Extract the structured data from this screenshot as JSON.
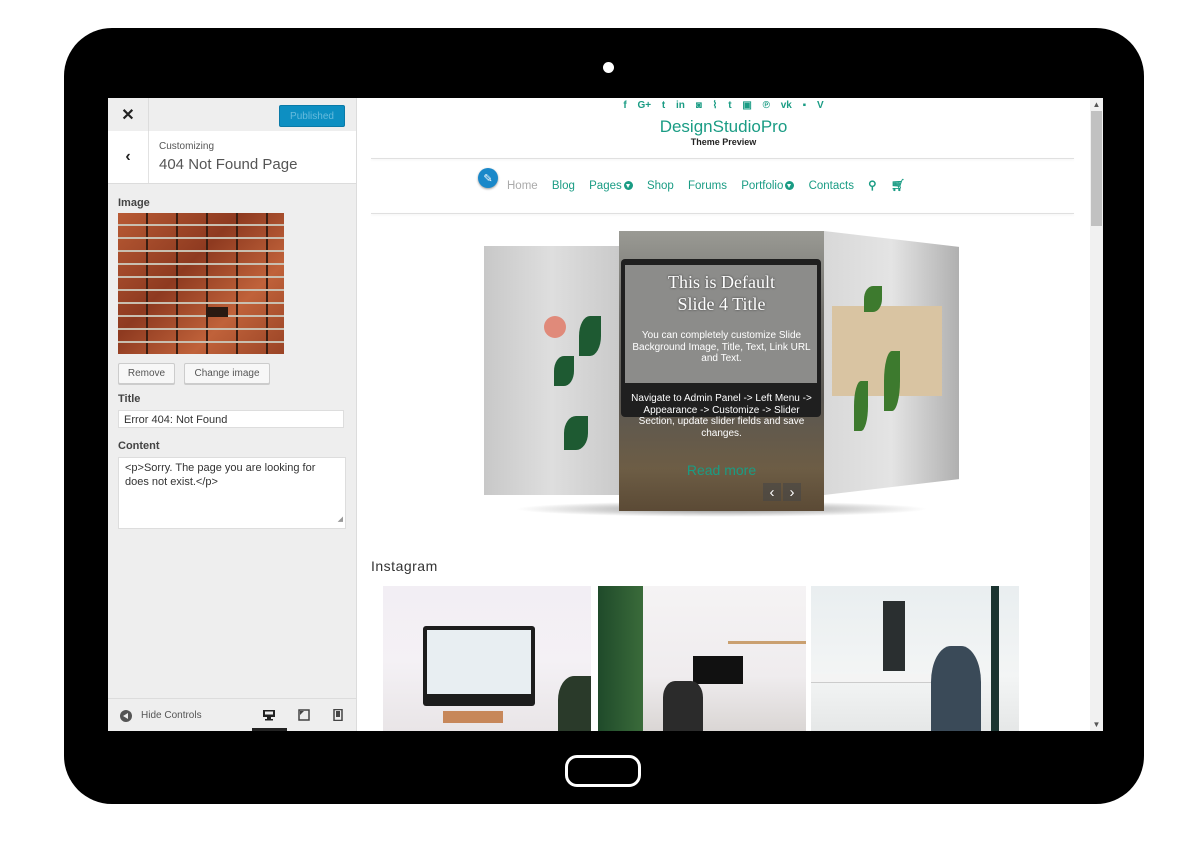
{
  "customizer": {
    "close_icon": "close-icon",
    "publish_label": "Published",
    "back_icon": "chevron-left-icon",
    "breadcrumb": "Customizing",
    "section_title": "404 Not Found Page",
    "image_label": "Image",
    "remove_label": "Remove",
    "change_image_label": "Change image",
    "title_label": "Title",
    "title_value": "Error 404: Not Found",
    "content_label": "Content",
    "content_value": "<p>Sorry. The page you are looking for does not exist.</p>",
    "footer": {
      "hide_controls_label": "Hide Controls",
      "devices": [
        "desktop",
        "tablet",
        "mobile"
      ],
      "active_device": "desktop"
    }
  },
  "preview": {
    "social_icons": [
      "f",
      "G+",
      "t",
      "in",
      "◙",
      "⌇",
      "t",
      "▣",
      "℗",
      "vk",
      "▪",
      "V"
    ],
    "social_names": [
      "facebook",
      "google-plus",
      "twitter",
      "linkedin",
      "instagram",
      "rss",
      "tumblr",
      "youtube",
      "pinterest",
      "vk",
      "flickr",
      "vine"
    ],
    "site_title": "DesignStudioPro",
    "tagline": "Theme Preview",
    "nav": {
      "home": "Home",
      "blog": "Blog",
      "pages": "Pages",
      "shop": "Shop",
      "forums": "Forums",
      "portfolio": "Portfolio",
      "contacts": "Contacts"
    },
    "slider": {
      "title_line1": "This is Default",
      "title_line2": "Slide 4 Title",
      "text": "You can completely customize Slide Background Image, Title, Text, Link URL and Text.",
      "text2": "Navigate to Admin Panel -> Left Menu -> Appearance -> Customize -> Slider Section, update slider fields and save changes.",
      "read_more": "Read more",
      "prev": "‹",
      "next": "›"
    },
    "instagram_title": "Instagram"
  },
  "colors": {
    "accent": "#1a9c84",
    "publish": "#0d8fc2",
    "edit_pencil": "#1a88c9"
  }
}
